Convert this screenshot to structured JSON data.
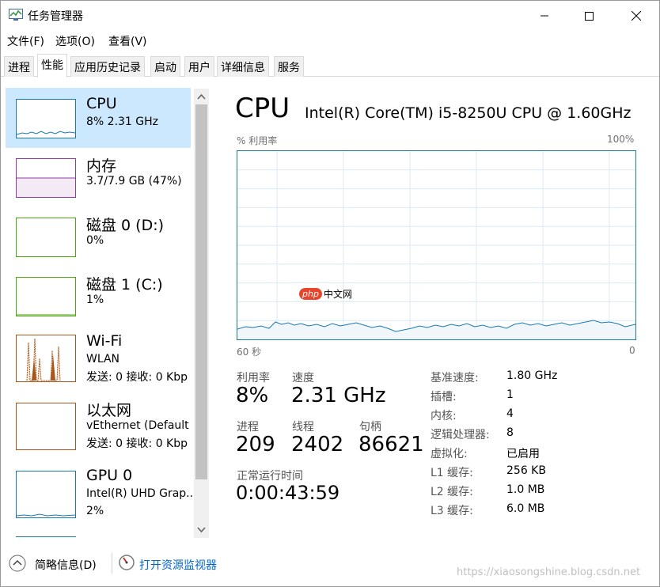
{
  "window": {
    "title": "任务管理器"
  },
  "menu": [
    "文件(F)",
    "选项(O)",
    "查看(V)"
  ],
  "tabs": [
    "进程",
    "性能",
    "应用历史记录",
    "启动",
    "用户",
    "详细信息",
    "服务"
  ],
  "sidebar": [
    {
      "name": "CPU",
      "sub1": "8% 2.31 GHz",
      "sub2": "",
      "color": "#1a7ab0"
    },
    {
      "name": "内存",
      "sub1": "3.7/7.9 GB (47%)",
      "sub2": "",
      "color": "#8b3fa0"
    },
    {
      "name": "磁盘 0 (D:)",
      "sub1": "0%",
      "sub2": "",
      "color": "#4da60c"
    },
    {
      "name": "磁盘 1 (C:)",
      "sub1": "1%",
      "sub2": "",
      "color": "#4da60c"
    },
    {
      "name": "Wi-Fi",
      "sub1": "WLAN",
      "sub2": "发送: 0 接收: 0 Kbp",
      "color": "#a7571b"
    },
    {
      "name": "以太网",
      "sub1": "vEthernet (Default",
      "sub2": "发送: 0 接收: 0 Kbp",
      "color": "#a7571b"
    },
    {
      "name": "GPU 0",
      "sub1": "Intel(R) UHD Grap...",
      "sub2": "2%",
      "color": "#1a7ab0"
    }
  ],
  "main": {
    "title": "CPU",
    "model": "Intel(R) Core(TM) i5-8250U CPU @ 1.60GHz",
    "graph_label_left": "% 利用率",
    "graph_label_right": "100%",
    "graph_time_left": "60 秒",
    "graph_time_right": "0",
    "graph_color": "#1a7ab0",
    "utilization_label": "利用率",
    "utilization": "8%",
    "speed_label": "速度",
    "speed": "2.31 GHz",
    "processes_label": "进程",
    "processes": "209",
    "threads_label": "线程",
    "threads": "2402",
    "handles_label": "句柄",
    "handles": "86621",
    "uptime_label": "正常运行时间",
    "uptime": "0:00:43:59",
    "specs": [
      {
        "label": "基准速度:",
        "value": "1.80 GHz"
      },
      {
        "label": "插槽:",
        "value": "1"
      },
      {
        "label": "内核:",
        "value": "4"
      },
      {
        "label": "逻辑处理器:",
        "value": "8"
      },
      {
        "label": "虚拟化:",
        "value": "已启用"
      },
      {
        "label": "L1 缓存:",
        "value": "256 KB"
      },
      {
        "label": "L2 缓存:",
        "value": "1.0 MB"
      },
      {
        "label": "L3 缓存:",
        "value": "6.0 MB"
      }
    ]
  },
  "footer": {
    "summary": "简略信息(D)",
    "monitor": "打开资源监视器"
  },
  "overlay": {
    "php_badge": "php",
    "php_site": "中文网",
    "watermark": "https://xiaosongshine.blog.csdn.net"
  }
}
